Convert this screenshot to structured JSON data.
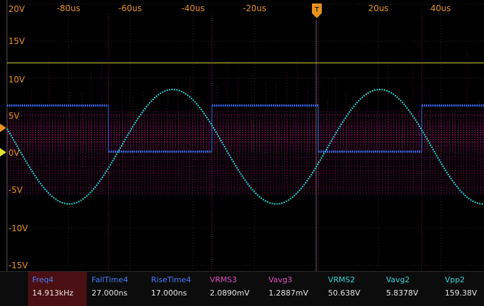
{
  "screen": {
    "time_axis": [
      "-80us",
      "-60us",
      "-40us",
      "-20us",
      "20us",
      "40us"
    ],
    "volt_axis": [
      "20V",
      "15V",
      "10V",
      "5V",
      "0V",
      "-5V",
      "-10V",
      "-15V"
    ],
    "trigger_marker": "T",
    "colors": {
      "grid": "#2f2f2f",
      "axis_text": "#e8921f",
      "ch4": "#3a63e0",
      "ch3": "#d81ea0",
      "ch2": "#26c8c8",
      "trigger_level": "#e0e030"
    }
  },
  "measurements": [
    {
      "name": "Freq4",
      "value": "14.913kHz",
      "color": "#4a7cff",
      "active": true
    },
    {
      "name": "FallTime4",
      "value": "27.000ns",
      "color": "#4a7cff",
      "active": false
    },
    {
      "name": "RiseTime4",
      "value": "17.000ns",
      "color": "#4a7cff",
      "active": false
    },
    {
      "name": "VRMS3",
      "value": "2.0890mV",
      "color": "#e04cc4",
      "active": false
    },
    {
      "name": "Vavg3",
      "value": "1.2887mV",
      "color": "#e04cc4",
      "active": false
    },
    {
      "name": "VRMS2",
      "value": "50.638V",
      "color": "#30d6d6",
      "active": false
    },
    {
      "name": "Vavg2",
      "value": "5.8378V",
      "color": "#30d6d6",
      "active": false
    },
    {
      "name": "Vpp2",
      "value": "159.38V",
      "color": "#30d6d6",
      "active": false
    }
  ]
}
